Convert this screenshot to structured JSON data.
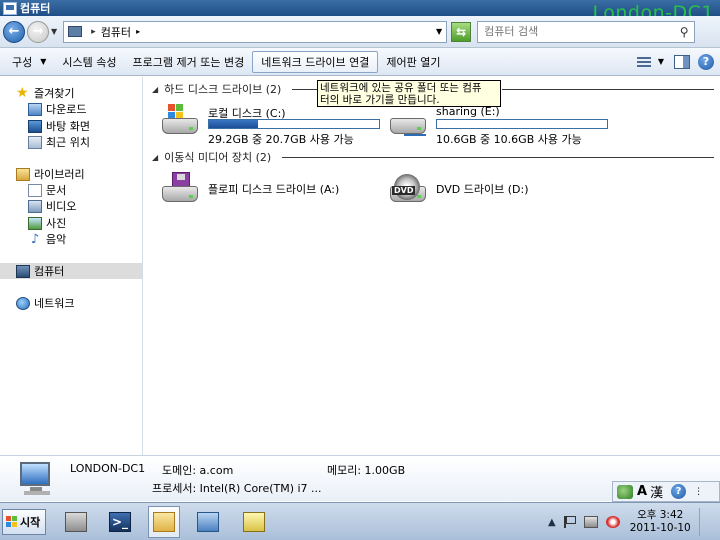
{
  "window": {
    "title": "컴퓨터",
    "watermark": "London-DC1"
  },
  "address": {
    "crumb": "컴퓨터",
    "search_placeholder": "컴퓨터 검색"
  },
  "toolbar": {
    "items": [
      {
        "label": "구성",
        "has_dropdown": true
      },
      {
        "label": "시스템 속성"
      },
      {
        "label": "프로그램 제거 또는 변경"
      },
      {
        "label": "네트워크 드라이브 연결",
        "active": true
      },
      {
        "label": "제어판 열기"
      }
    ]
  },
  "sidebar": {
    "favorites": {
      "label": "즐겨찾기",
      "items": [
        "다운로드",
        "바탕 화면",
        "최근 위치"
      ]
    },
    "libraries": {
      "label": "라이브러리",
      "items": [
        "문서",
        "비디오",
        "사진",
        "음악"
      ]
    },
    "computer": {
      "label": "컴퓨터"
    },
    "network": {
      "label": "네트워크"
    }
  },
  "content": {
    "hard_drives": {
      "header": "하드 디스크 드라이브 (2)",
      "drives": [
        {
          "name": "로컬 디스크 (C:)",
          "usage": "29.2GB 중 20.7GB 사용 가능",
          "used_fraction": 0.29
        },
        {
          "name": "sharing (E:)",
          "usage": "10.6GB 중 10.6GB 사용 가능",
          "used_fraction": 0.0
        }
      ]
    },
    "removable": {
      "header": "이동식 미디어 장치 (2)",
      "drives": [
        {
          "name": "플로피 디스크 드라이브 (A:)"
        },
        {
          "name": "DVD 드라이브 (D:)",
          "badge": "DVD"
        }
      ]
    },
    "tooltip": {
      "line1": "네트워크에 있는 공유 폴더 또는 컴퓨",
      "line2": "터의 바로 가기를 만듭니다."
    }
  },
  "details": {
    "name": "LONDON-DC1",
    "domain": "도메인: a.com",
    "memory": "메모리: 1.00GB",
    "processor": "프로세서: Intel(R) Core(TM) i7 ..."
  },
  "langbar": {
    "a": "A",
    "han": "漢",
    "help": "?"
  },
  "taskbar": {
    "start_label": "시작",
    "powershell_glyph": ">_",
    "clock_time": "오후 3:42",
    "clock_date": "2011-10-10"
  },
  "help_glyph": "?"
}
